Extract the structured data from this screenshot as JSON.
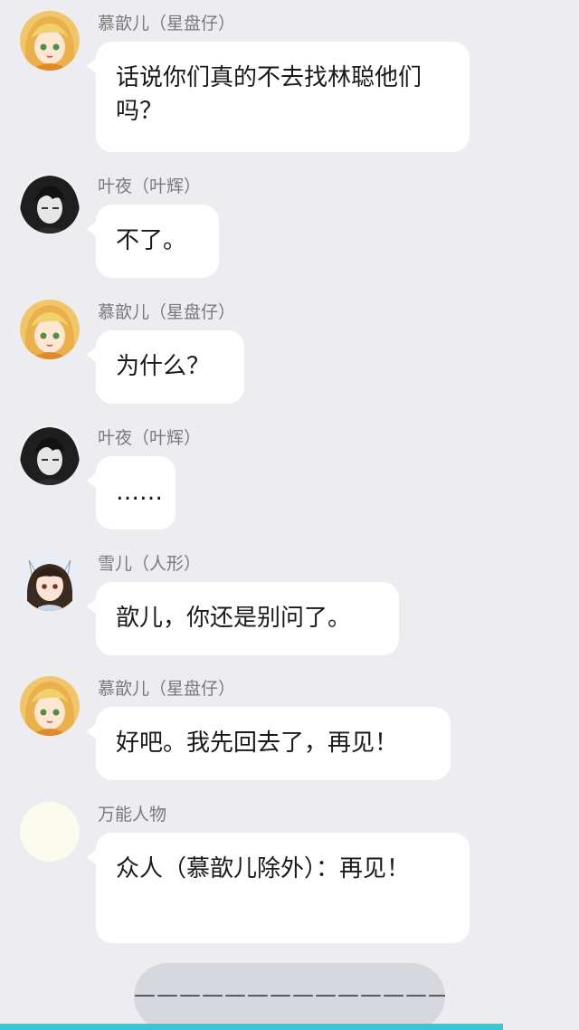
{
  "messages": [
    {
      "name": "慕歆儿（星盘仔）",
      "avatar": "blonde-girl-avatar",
      "text": "话说你们真的不去找林聪他们吗？"
    },
    {
      "name": "叶夜（叶辉）",
      "avatar": "dark-hair-boy-avatar",
      "text": "不了。"
    },
    {
      "name": "慕歆儿（星盘仔）",
      "avatar": "blonde-girl-avatar",
      "text": "为什么？"
    },
    {
      "name": "叶夜（叶辉）",
      "avatar": "dark-hair-boy-avatar",
      "text": "……"
    },
    {
      "name": "雪儿（人形）",
      "avatar": "fox-ear-girl-avatar",
      "text": "歆儿，你还是别问了。"
    },
    {
      "name": "慕歆儿（星盘仔）",
      "avatar": "blonde-girl-avatar",
      "text": "好吧。我先回去了，再见！"
    },
    {
      "name": "万能人物",
      "avatar": "blank-avatar",
      "text": "众人（慕歆儿除外）：再见！"
    }
  ],
  "divider": {
    "text": "——————————————"
  },
  "colors": {
    "background": "#ededf1",
    "bubble": "#ffffff",
    "name_text": "#7a7a7a",
    "accent_bar": "#36c8d6"
  }
}
